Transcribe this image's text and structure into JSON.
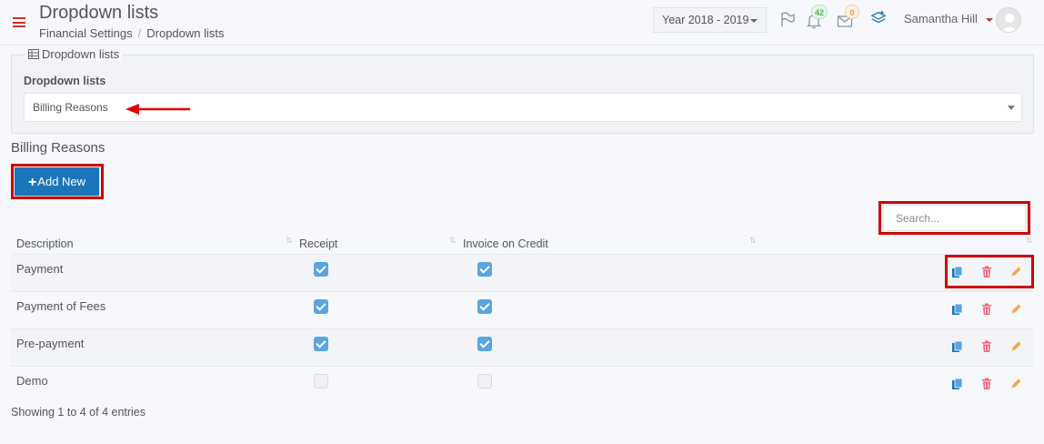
{
  "header": {
    "title": "Dropdown lists",
    "breadcrumb": [
      "Financial Settings",
      "/",
      "Dropdown lists"
    ],
    "year_select": "Year 2018 - 2019",
    "notifications_count": "42",
    "messages_count": "0",
    "user_name": "Samantha Hill"
  },
  "panel": {
    "legend": "Dropdown lists",
    "label": "Dropdown lists",
    "selected_value": "Billing Reasons"
  },
  "section": {
    "title": "Billing Reasons",
    "add_button": "Add New",
    "search_placeholder": "Search..."
  },
  "table": {
    "columns": [
      "Description",
      "Receipt",
      "Invoice on Credit",
      ""
    ],
    "rows": [
      {
        "description": "Payment",
        "receipt": true,
        "invoice_on_credit": true
      },
      {
        "description": "Payment of Fees",
        "receipt": true,
        "invoice_on_credit": true
      },
      {
        "description": "Pre-payment",
        "receipt": true,
        "invoice_on_credit": true
      },
      {
        "description": "Demo",
        "receipt": false,
        "invoice_on_credit": false
      }
    ],
    "row_actions": [
      "copy-icon",
      "delete-icon",
      "edit-icon"
    ]
  },
  "footer": {
    "info": "Showing 1 to 4 of 4 entries"
  },
  "colors": {
    "accent": "#1b75bb",
    "checkbox": "#5aa4e0",
    "highlight_red": "#d00000",
    "delete": "#e8697a",
    "edit": "#f3a54a"
  }
}
